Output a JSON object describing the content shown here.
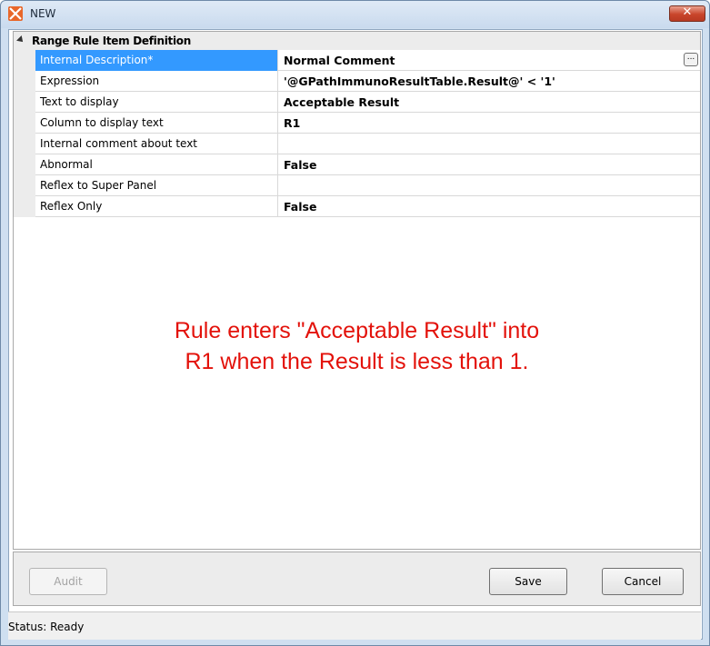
{
  "window": {
    "title": "NEW",
    "close_label": "✕",
    "app_icon": "app-logo-icon"
  },
  "grid": {
    "category_label": "Range Rule Item Definition",
    "rows": [
      {
        "name": "Internal Description*",
        "value": "Normal Comment",
        "selected": true,
        "has_ellipsis": true
      },
      {
        "name": "Expression",
        "value": "'@GPathImmunoResultTable.Result@' < '1'"
      },
      {
        "name": "Text to display",
        "value": "Acceptable Result"
      },
      {
        "name": "Column to display text",
        "value": "R1"
      },
      {
        "name": "Internal comment about text",
        "value": ""
      },
      {
        "name": "Abnormal",
        "value": "False"
      },
      {
        "name": "Reflex to Super Panel",
        "value": ""
      },
      {
        "name": "Reflex Only",
        "value": "False"
      }
    ],
    "ellipsis_label": "..."
  },
  "annotation": {
    "line1": "Rule enters \"Acceptable Result\" into",
    "line2": "R1 when the Result is less than 1.",
    "color": "#e3120b"
  },
  "buttons": {
    "audit_label": "Audit",
    "save_label": "Save",
    "cancel_label": "Cancel"
  },
  "status": {
    "text": "Status: Ready"
  },
  "colors": {
    "selection": "#3399ff",
    "close_button": "#c9452b",
    "app_icon": "#e8672a"
  }
}
